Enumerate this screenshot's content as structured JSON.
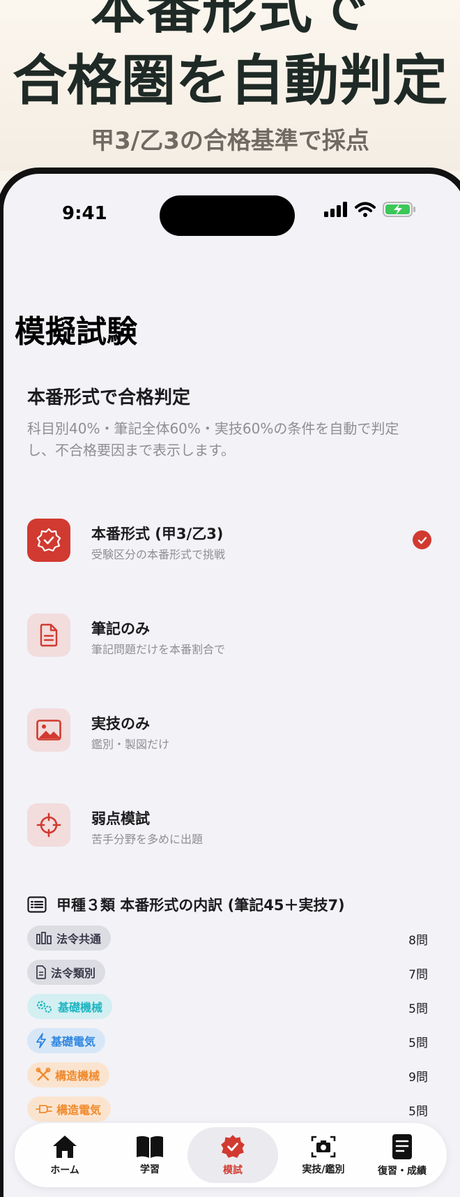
{
  "hero": {
    "line1": "本番形式で",
    "line2": "合格圏を自動判定",
    "subtitle": "甲3/乙3の合格基準で採点"
  },
  "status_bar": {
    "time": "9:41"
  },
  "page": {
    "title": "模擬試験"
  },
  "intro": {
    "title": "本番形式で合格判定",
    "description": "科目別40%・筆記全体60%・実技60%の条件を自動で判定し、不合格要因まで表示します。"
  },
  "modes": [
    {
      "title": "本番形式 (甲3/乙3)",
      "subtitle": "受験区分の本番形式で挑戦",
      "icon": "badge-check-icon",
      "selected": true
    },
    {
      "title": "筆記のみ",
      "subtitle": "筆記問題だけを本番割合で",
      "icon": "document-icon",
      "selected": false
    },
    {
      "title": "実技のみ",
      "subtitle": "鑑別・製図だけ",
      "icon": "image-icon",
      "selected": false
    },
    {
      "title": "弱点模試",
      "subtitle": "苦手分野を多めに出題",
      "icon": "crosshair-icon",
      "selected": false
    }
  ],
  "breakdown": {
    "title": "甲種３類 本番形式の内訳 (筆記45＋実技7)",
    "rows": [
      {
        "label": "法令共通",
        "count": "8問",
        "icon": "building-icon",
        "color": "#3a3a4c",
        "bg": "#dcdde3"
      },
      {
        "label": "法令類別",
        "count": "7問",
        "icon": "document-icon",
        "color": "#3a3a4c",
        "bg": "#dcdde3"
      },
      {
        "label": "基礎機械",
        "count": "5問",
        "icon": "gears-icon",
        "color": "#1fb5c2",
        "bg": "#d3eff1"
      },
      {
        "label": "基礎電気",
        "count": "5問",
        "icon": "bolt-icon",
        "color": "#2f86e0",
        "bg": "#d8e7f7"
      },
      {
        "label": "構造機械",
        "count": "9問",
        "icon": "tools-icon",
        "color": "#f08a2c",
        "bg": "#fbe4cf"
      },
      {
        "label": "構造電気",
        "count": "5問",
        "icon": "plug-icon",
        "color": "#f08a2c",
        "bg": "#fbe4cf"
      }
    ]
  },
  "tabs": [
    {
      "label": "ホーム",
      "icon": "home-icon",
      "active": false
    },
    {
      "label": "学習",
      "icon": "book-icon",
      "active": false
    },
    {
      "label": "模試",
      "icon": "badge-check-icon",
      "active": true
    },
    {
      "label": "実技/鑑別",
      "icon": "camera-icon",
      "active": false
    },
    {
      "label": "復習・成績",
      "icon": "notes-icon",
      "active": false
    }
  ],
  "colors": {
    "accent": "#d13a30",
    "background": "#f2f2f7",
    "hero_bg": "#f7f2ea"
  }
}
